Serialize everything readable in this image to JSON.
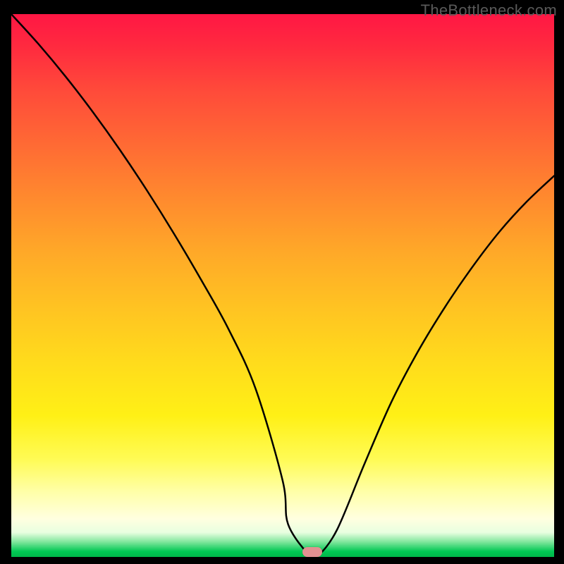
{
  "attribution": "TheBottleneck.com",
  "chart_data": {
    "type": "line",
    "title": "",
    "xlabel": "",
    "ylabel": "",
    "xlim": [
      0,
      1
    ],
    "ylim": [
      0,
      1
    ],
    "x": [
      0.0,
      0.05,
      0.1,
      0.15,
      0.2,
      0.25,
      0.3,
      0.35,
      0.4,
      0.45,
      0.5,
      0.51,
      0.55,
      0.565,
      0.6,
      0.65,
      0.7,
      0.75,
      0.8,
      0.85,
      0.9,
      0.95,
      1.0
    ],
    "values": [
      1.0,
      0.945,
      0.885,
      0.82,
      0.75,
      0.675,
      0.595,
      0.51,
      0.42,
      0.31,
      0.14,
      0.06,
      0.002,
      0.002,
      0.05,
      0.17,
      0.285,
      0.38,
      0.462,
      0.535,
      0.6,
      0.655,
      0.702
    ],
    "marker_x_frac": 0.555,
    "marker_width_frac": 0.036,
    "axes_visible": false,
    "grid": false
  }
}
